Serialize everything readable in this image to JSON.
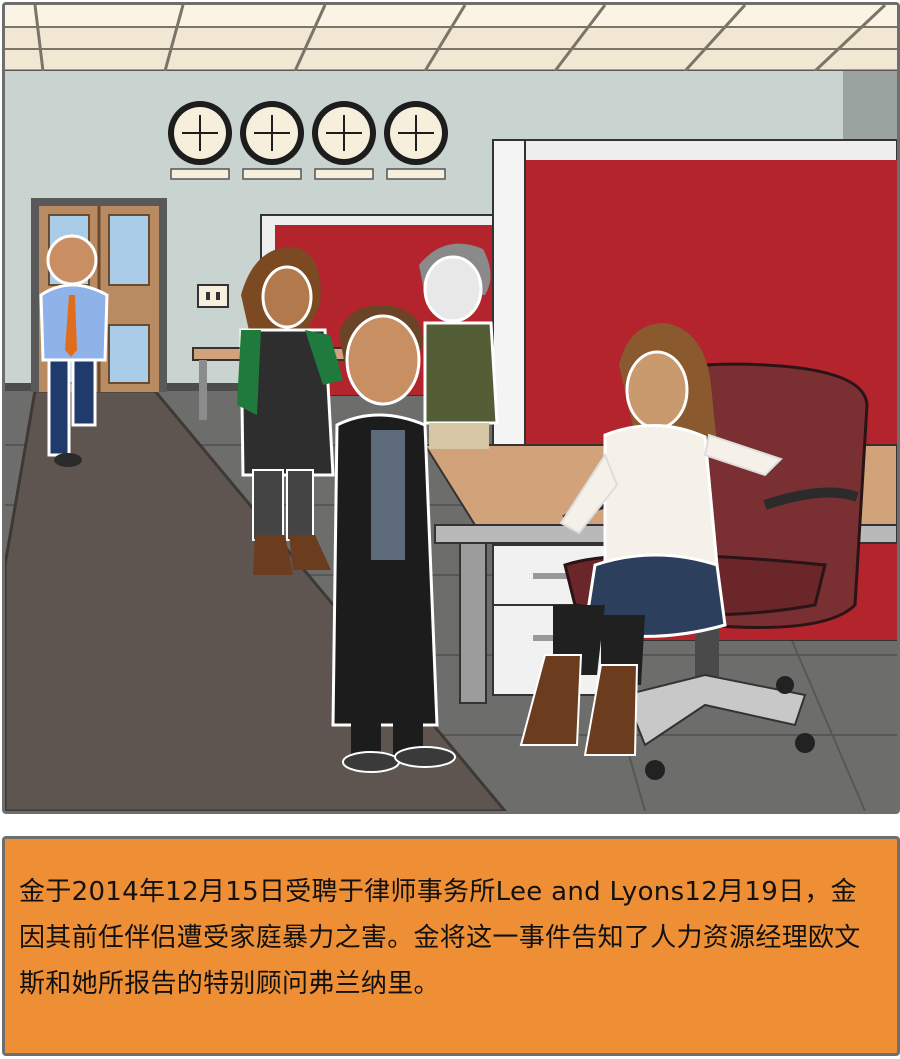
{
  "scene": {
    "name": "office-scene",
    "colors": {
      "wall": "#c9d3cf",
      "floor": "#6d6e6c",
      "carpet": "#5e5550",
      "cubicle": "#b3242c",
      "desk": "#d2a27a",
      "chair": "#7a2f33",
      "caption_bg": "#ef8f35"
    }
  },
  "caption": {
    "text": "金于2014年12月15日受聘于律师事务所Lee and Lyons12月19日，金因其前任伴侣遭受家庭暴力之害。金将这一事件告知了人力资源经理欧文斯和她所报告的特别顾问弗兰纳里。"
  }
}
